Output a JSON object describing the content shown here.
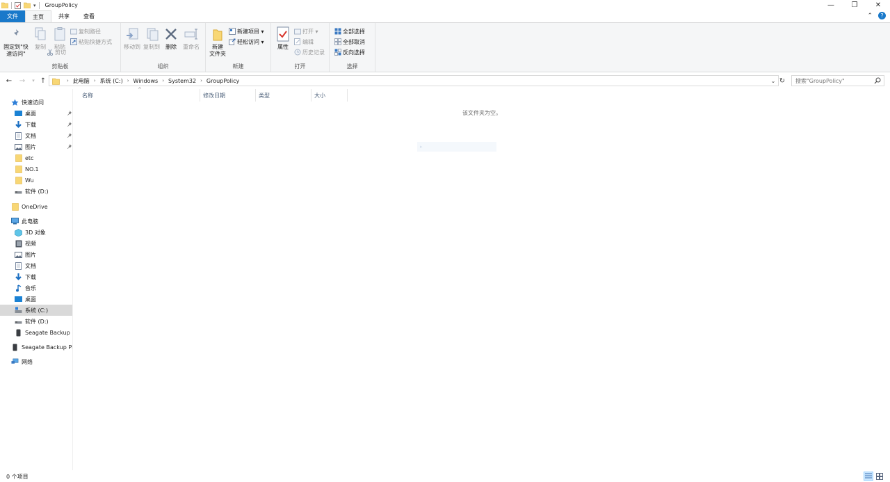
{
  "window": {
    "title": "GroupPolicy",
    "controls": {
      "minimize": "—",
      "restore": "❐",
      "close": "✕"
    }
  },
  "ribbon_tabs": [
    {
      "label": "文件"
    },
    {
      "label": "主页"
    },
    {
      "label": "共享"
    },
    {
      "label": "查看"
    }
  ],
  "ribbon": {
    "clipboard": {
      "label": "剪贴板",
      "pin": "固定到\"快\n速访问\"",
      "copy": "复制",
      "paste": "粘贴",
      "copy_path": "复制路径",
      "paste_shortcut": "粘贴快捷方式",
      "cut": "剪切"
    },
    "organize": {
      "label": "组织",
      "move_to": "移动到",
      "copy_to": "复制到",
      "delete": "删除",
      "rename": "重命名"
    },
    "new": {
      "label": "新建",
      "new_folder": "新建\n文件夹",
      "new_item": "新建项目 ▾",
      "easy_access": "轻松访问 ▾"
    },
    "open": {
      "label": "打开",
      "properties": "属性",
      "open": "打开 ▾",
      "edit": "编辑",
      "history": "历史记录"
    },
    "select": {
      "label": "选择",
      "select_all": "全部选择",
      "select_none": "全部取消",
      "invert": "反向选择"
    }
  },
  "address": {
    "crumbs": [
      "此电脑",
      "系统 (C:)",
      "Windows",
      "System32",
      "GroupPolicy"
    ],
    "search_placeholder": "搜索\"GroupPolicy\""
  },
  "sidebar": {
    "quick_access": "快速访问",
    "quick_items": [
      {
        "label": "桌面",
        "icon": "desktop-icon",
        "pinned": true
      },
      {
        "label": "下载",
        "icon": "download-icon",
        "pinned": true
      },
      {
        "label": "文档",
        "icon": "document-icon",
        "pinned": true
      },
      {
        "label": "图片",
        "icon": "picture-icon",
        "pinned": true
      },
      {
        "label": "etc",
        "icon": "folder-icon",
        "pinned": false
      },
      {
        "label": "NO.1",
        "icon": "folder-icon",
        "pinned": false
      },
      {
        "label": "Wu",
        "icon": "folder-icon",
        "pinned": false
      },
      {
        "label": "软件 (D:)",
        "icon": "drive-icon",
        "pinned": false
      }
    ],
    "onedrive": "OneDrive",
    "this_pc": "此电脑",
    "pc_items": [
      {
        "label": "3D 对象",
        "icon": "cube-icon"
      },
      {
        "label": "视频",
        "icon": "video-icon"
      },
      {
        "label": "图片",
        "icon": "picture-icon"
      },
      {
        "label": "文档",
        "icon": "document-icon"
      },
      {
        "label": "下载",
        "icon": "download-icon"
      },
      {
        "label": "音乐",
        "icon": "music-icon"
      },
      {
        "label": "桌面",
        "icon": "desktop-icon"
      },
      {
        "label": "系统 (C:)",
        "icon": "system-drive-icon",
        "selected": true
      },
      {
        "label": "软件 (D:)",
        "icon": "drive-icon"
      },
      {
        "label": "Seagate Backup P",
        "icon": "external-drive-icon"
      }
    ],
    "seagate": "Seagate Backup Plu",
    "network": "网络"
  },
  "columns": [
    "名称",
    "修改日期",
    "类型",
    "大小"
  ],
  "empty_message": "该文件夹为空。",
  "status": {
    "item_count": "0 个项目"
  },
  "colors": {
    "accent": "#1979ca",
    "selected": "#d9d9d9",
    "folder": "#f8d775"
  }
}
